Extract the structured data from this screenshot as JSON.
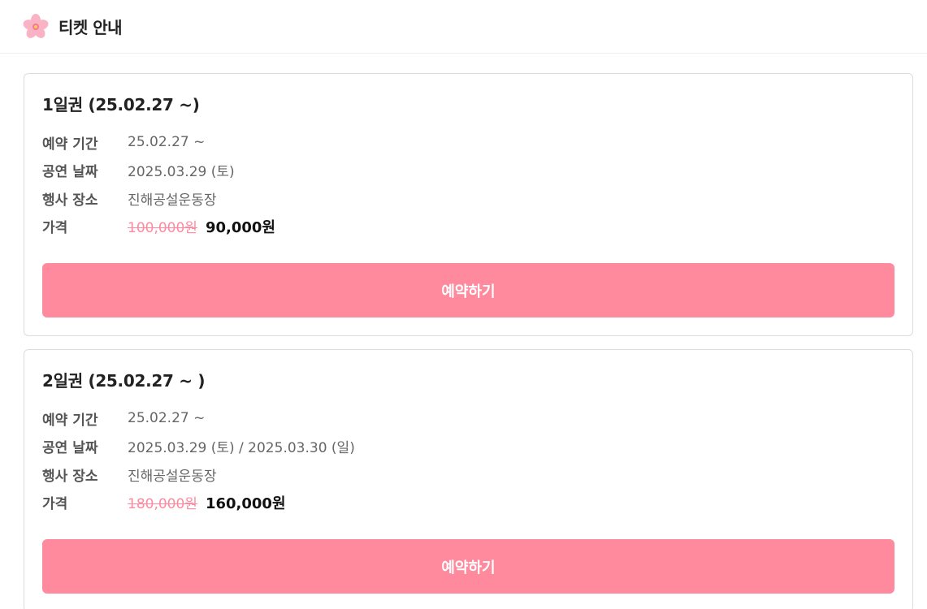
{
  "header": {
    "logo_icon": "cherry-blossom-icon",
    "title": "티켓 안내"
  },
  "colors": {
    "accent": "#ff8a9e",
    "strike": "#ff8aa0",
    "border": "#dcdcdc"
  },
  "tickets": [
    {
      "title": "1일권 (25.02.27 ~)",
      "rows": [
        {
          "label": "예약 기간",
          "value": "25.02.27 ~"
        },
        {
          "label": "공연 날짜",
          "value": "2025.03.29 (토)"
        },
        {
          "label": "행사 장소",
          "value": "진해공설운동장"
        }
      ],
      "price_label": "가격",
      "price_original": "100,000원",
      "price_sale": "90,000원",
      "button_label": "예약하기"
    },
    {
      "title": "2일권 (25.02.27 ~ )",
      "rows": [
        {
          "label": "예약 기간",
          "value": "25.02.27 ~"
        },
        {
          "label": "공연 날짜",
          "value": "2025.03.29 (토) / 2025.03.30 (일)"
        },
        {
          "label": "행사 장소",
          "value": "진해공설운동장"
        }
      ],
      "price_label": "가격",
      "price_original": "180,000원",
      "price_sale": "160,000원",
      "button_label": "예약하기"
    }
  ]
}
